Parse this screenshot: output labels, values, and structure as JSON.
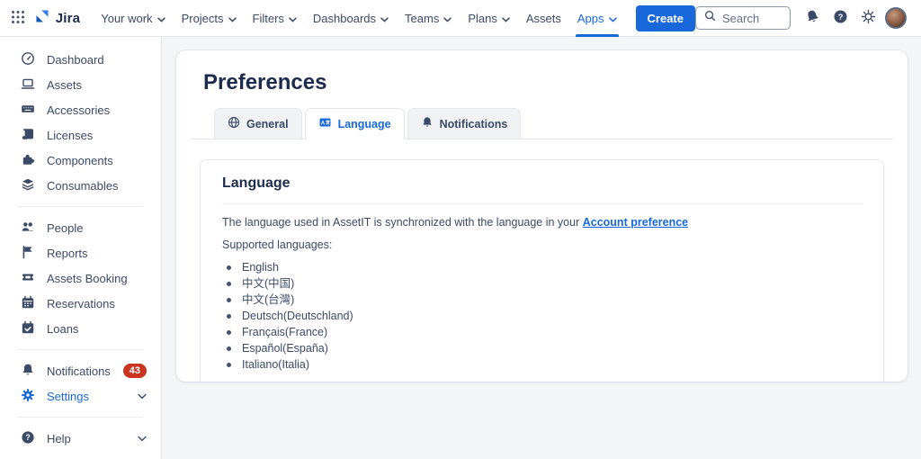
{
  "colors": {
    "accent": "#1868DB",
    "badge_red": "#CA3521",
    "text_dark": "#1D2B4C",
    "text_body": "#3B4A66",
    "page_bg": "#F4F5F7"
  },
  "topbar": {
    "app_switcher_icon": "grid-icon",
    "brand": "Jira",
    "brand_icon": "jira-logo-icon",
    "nav": [
      {
        "label": "Your work",
        "chevron": true
      },
      {
        "label": "Projects",
        "chevron": true
      },
      {
        "label": "Filters",
        "chevron": true
      },
      {
        "label": "Dashboards",
        "chevron": true
      },
      {
        "label": "Teams",
        "chevron": true
      },
      {
        "label": "Plans",
        "chevron": true
      },
      {
        "label": "Assets",
        "chevron": false
      },
      {
        "label": "Apps",
        "chevron": true,
        "active": true
      }
    ],
    "create_label": "Create",
    "search": {
      "placeholder": "Search",
      "icon": "search-icon"
    },
    "right_icons": [
      "bell-icon",
      "help-icon",
      "gear-icon",
      "avatar"
    ]
  },
  "sidebar": {
    "groups": [
      {
        "items": [
          {
            "label": "Dashboard",
            "icon": "gauge-icon"
          },
          {
            "label": "Assets",
            "icon": "laptop-icon"
          },
          {
            "label": "Accessories",
            "icon": "keyboard-icon"
          },
          {
            "label": "Licenses",
            "icon": "license-icon"
          },
          {
            "label": "Components",
            "icon": "puzzle-icon"
          },
          {
            "label": "Consumables",
            "icon": "layers-icon"
          }
        ]
      },
      {
        "items": [
          {
            "label": "People",
            "icon": "people-icon"
          },
          {
            "label": "Reports",
            "icon": "flag-icon"
          },
          {
            "label": "Assets Booking",
            "icon": "ticket-icon"
          },
          {
            "label": "Reservations",
            "icon": "calendar-icon"
          },
          {
            "label": "Loans",
            "icon": "calendar-check-icon"
          }
        ]
      },
      {
        "items": [
          {
            "label": "Notifications",
            "icon": "bell-icon",
            "badge": "43"
          },
          {
            "label": "Settings",
            "icon": "gear-icon",
            "active": true,
            "chevron": true
          }
        ]
      },
      {
        "items": [
          {
            "label": "Help",
            "icon": "help-icon",
            "chevron": true
          }
        ]
      }
    ]
  },
  "main": {
    "title": "Preferences",
    "tabs": [
      {
        "label": "General",
        "icon": "globe-icon",
        "active": false
      },
      {
        "label": "Language",
        "icon": "translate-icon",
        "active": true
      },
      {
        "label": "Notifications",
        "icon": "bell-icon",
        "active": false
      }
    ],
    "card": {
      "title": "Language",
      "sync_text": "The language used in AssetIT is synchronized with the language in your",
      "sync_link": "Account preference",
      "supported_label": "Supported languages:",
      "languages": [
        "English",
        "中文(中国)",
        "中文(台灣)",
        "Deutsch(Deutschland)",
        "Français(France)",
        "Español(España)",
        "Italiano(Italia)"
      ]
    }
  }
}
